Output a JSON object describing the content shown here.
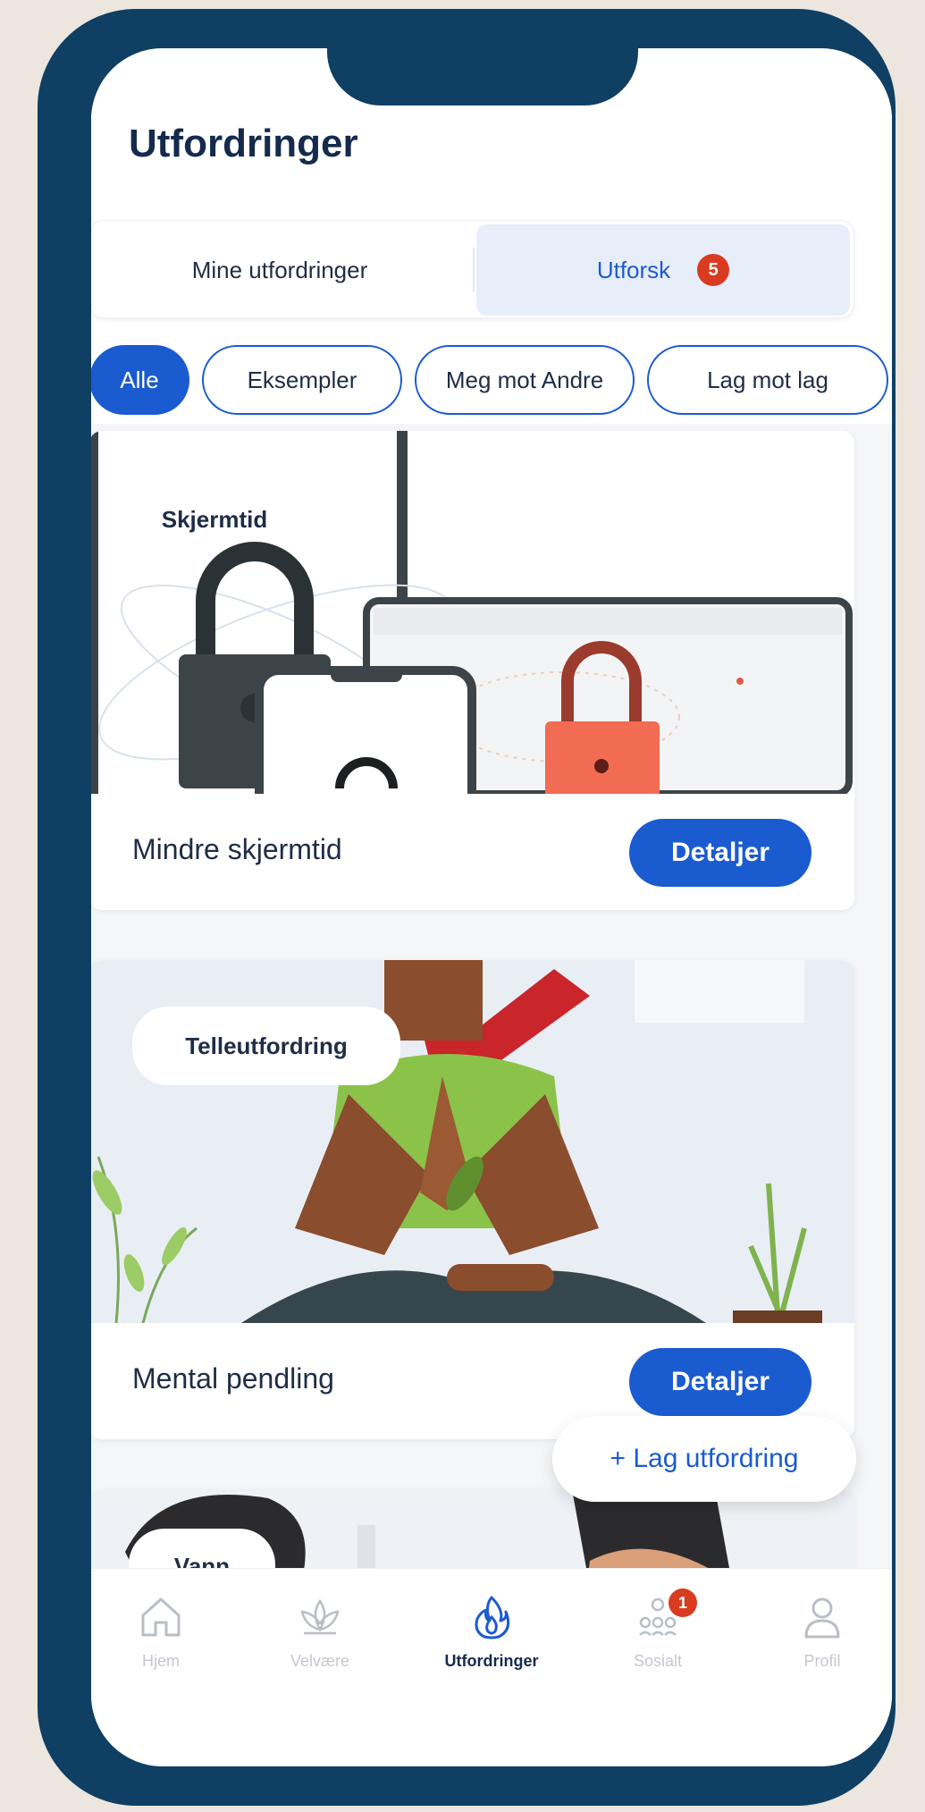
{
  "page": {
    "title": "Utfordringer"
  },
  "segments": {
    "mine": "Mine utfordringer",
    "explore": "Utforsk",
    "explore_badge": "5"
  },
  "filters": [
    "Alle",
    "Eksempler",
    "Meg mot Andre",
    "Lag mot lag"
  ],
  "cards": [
    {
      "tag": "Skjermtid",
      "title": "Mindre skjermtid",
      "button": "Detaljer"
    },
    {
      "tag": "Telleutfordring",
      "title": "Mental pendling",
      "button": "Detaljer"
    },
    {
      "tag": "Vann"
    }
  ],
  "fab": {
    "label": "+ Lag utfordring"
  },
  "tabbar": {
    "items": [
      {
        "label": "Hjem",
        "icon": "home-icon"
      },
      {
        "label": "Velvære",
        "icon": "lotus-icon"
      },
      {
        "label": "Utfordringer",
        "icon": "flame-icon"
      },
      {
        "label": "Sosialt",
        "icon": "people-icon",
        "badge": "1"
      },
      {
        "label": "Profil",
        "icon": "person-icon"
      }
    ]
  },
  "colors": {
    "frame": "#0f3f63",
    "accent": "#1b5bd0",
    "badge": "#d93b20",
    "title": "#152a4d"
  }
}
